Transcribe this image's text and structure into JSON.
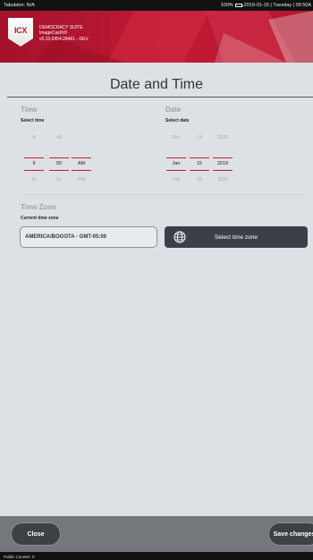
{
  "status_bar": {
    "left": "Tabulator: N/A",
    "battery": "100%",
    "right": "2019-01-15 | Tuesday | 09:50A"
  },
  "header": {
    "logo": "ICX",
    "suite": "DEMOCRACY SUITE",
    "product": "ImageCastX®",
    "version": "v5.10.6954.28461 - DEV"
  },
  "page": {
    "title": "Date and Time"
  },
  "time": {
    "title": "Time",
    "label": "Select time",
    "hour": {
      "prev": "8",
      "value": "9",
      "next": "10"
    },
    "separator": ":",
    "minute": {
      "prev": "49",
      "value": "50",
      "next": "51"
    },
    "ampm": {
      "prev": "",
      "value": "AM",
      "next": "PM"
    }
  },
  "date": {
    "title": "Date",
    "label": "Select date",
    "month": {
      "prev": "Dec",
      "value": "Jan",
      "next": "Feb"
    },
    "day": {
      "prev": "14",
      "value": "15",
      "next": "16"
    },
    "year": {
      "prev": "2018",
      "value": "2019",
      "next": "2020"
    }
  },
  "time_zone": {
    "title": "Time Zone",
    "label": "Current time zone",
    "current": "AMERICA/BOGOTA - GMT-05:00",
    "button": "Select time zone",
    "icon": "globe-icon"
  },
  "footer": {
    "close": "Close",
    "save": "Save changes"
  },
  "bottom_bar": {
    "text": "Public Counter: 0"
  },
  "colors": {
    "accent": "#c0203a",
    "banner": "#b5172f",
    "button": "#3d4045"
  }
}
